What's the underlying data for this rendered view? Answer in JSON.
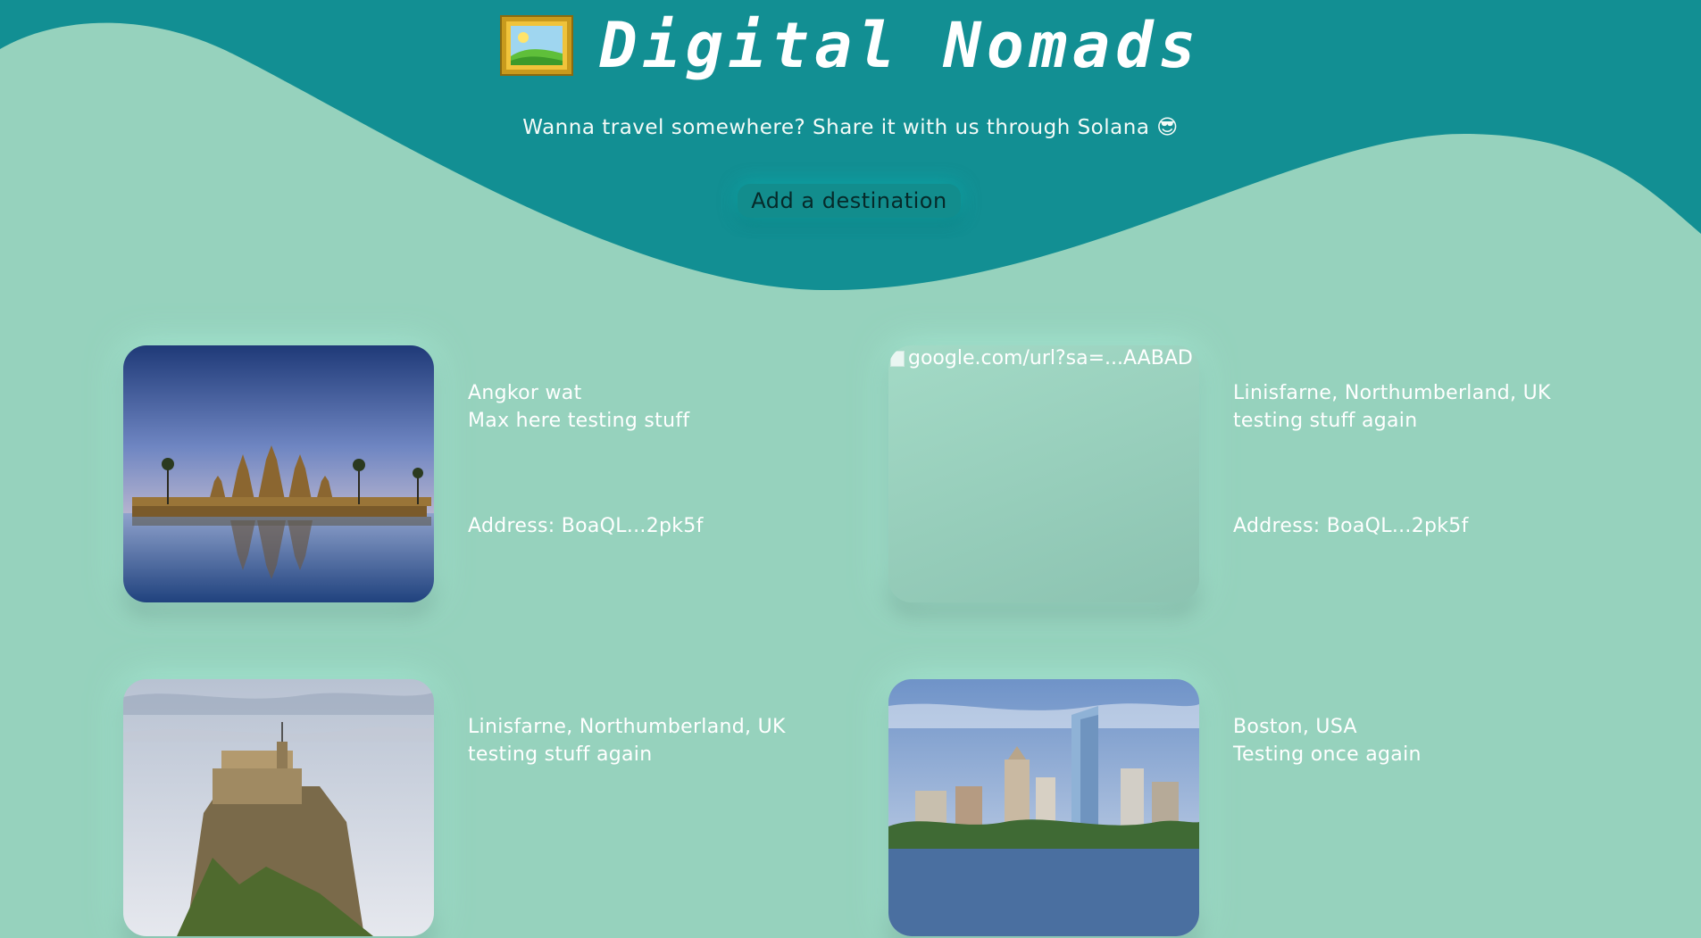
{
  "header": {
    "title": "Digital Nomads",
    "title_icon": "framed-picture-icon",
    "subtitle": "Wanna travel somewhere? Share it with us through Solana 😎",
    "add_button_label": "Add a destination"
  },
  "colors": {
    "background": "#96d2bd",
    "wave": "#128f93",
    "text": "#ffffff"
  },
  "destinations": [
    {
      "name": "Angkor wat",
      "description": "Max here testing stuff",
      "address": "Address: BoaQL...2pk5f",
      "image": "angkor-wat-photo"
    },
    {
      "name": "Linisfarne, Northumberland, UK",
      "description": "testing stuff again",
      "address": "Address: BoaQL...2pk5f",
      "image_alt": "google.com/url?sa=...AABAD",
      "image": "broken-image"
    },
    {
      "name": "Linisfarne, Northumberland, UK",
      "description": "testing stuff again",
      "address": "",
      "image": "lindisfarne-castle-photo"
    },
    {
      "name": "Boston, USA",
      "description": "Testing once again",
      "address": "",
      "image": "boston-skyline-photo"
    }
  ]
}
